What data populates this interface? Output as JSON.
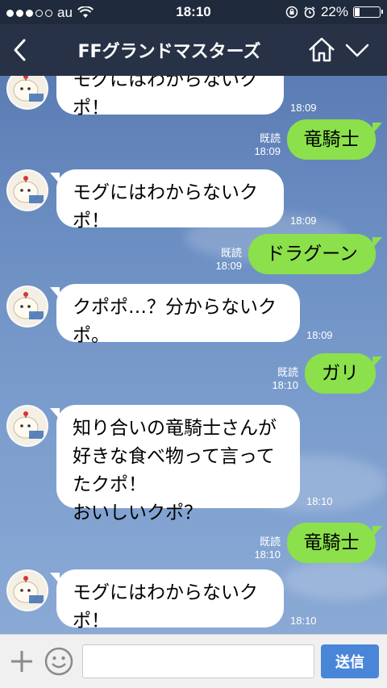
{
  "status_bar": {
    "carrier": "au",
    "time": "18:10",
    "battery_percent": "22%",
    "battery_level": 0.22
  },
  "header": {
    "title": "FFグランドマスターズ"
  },
  "messages": [
    {
      "side": "left",
      "lines": [
        "モグにはわからないク",
        "ポ！"
      ],
      "time": "18:09"
    },
    {
      "side": "right",
      "text": "竜騎士",
      "read": "既読",
      "time": "18:09"
    },
    {
      "side": "left",
      "lines": [
        "モグにはわからないク",
        "ポ！"
      ],
      "time": "18:09"
    },
    {
      "side": "right",
      "text": "ドラグーン",
      "read": "既読",
      "time": "18:09"
    },
    {
      "side": "left",
      "lines": [
        "クポポ…？分からないク",
        "ポ。"
      ],
      "time": "18:09"
    },
    {
      "side": "right",
      "text": "ガリ",
      "read": "既読",
      "time": "18:10"
    },
    {
      "side": "left",
      "lines": [
        "知り合いの竜騎士さんが",
        "好きな食べ物って言って",
        "たクポ！",
        "おいしいクポ？"
      ],
      "time": "18:10"
    },
    {
      "side": "right",
      "text": "竜騎士",
      "read": "既読",
      "time": "18:10"
    },
    {
      "side": "left",
      "lines": [
        "モグにはわからないク",
        "ポ！"
      ],
      "time": "18:10"
    }
  ],
  "input_bar": {
    "placeholder": "",
    "send_label": "送信"
  },
  "colors": {
    "header_bg": "#273246",
    "chat_bg": "#6c8fc3",
    "bubble_sent": "#8be04b",
    "send_button": "#4a86d8"
  },
  "icons": [
    "back-chevron-icon",
    "home-icon",
    "chevron-down-icon",
    "plus-icon",
    "emoji-icon",
    "wifi-icon",
    "lock-rotation-icon",
    "alarm-icon",
    "battery-icon"
  ]
}
